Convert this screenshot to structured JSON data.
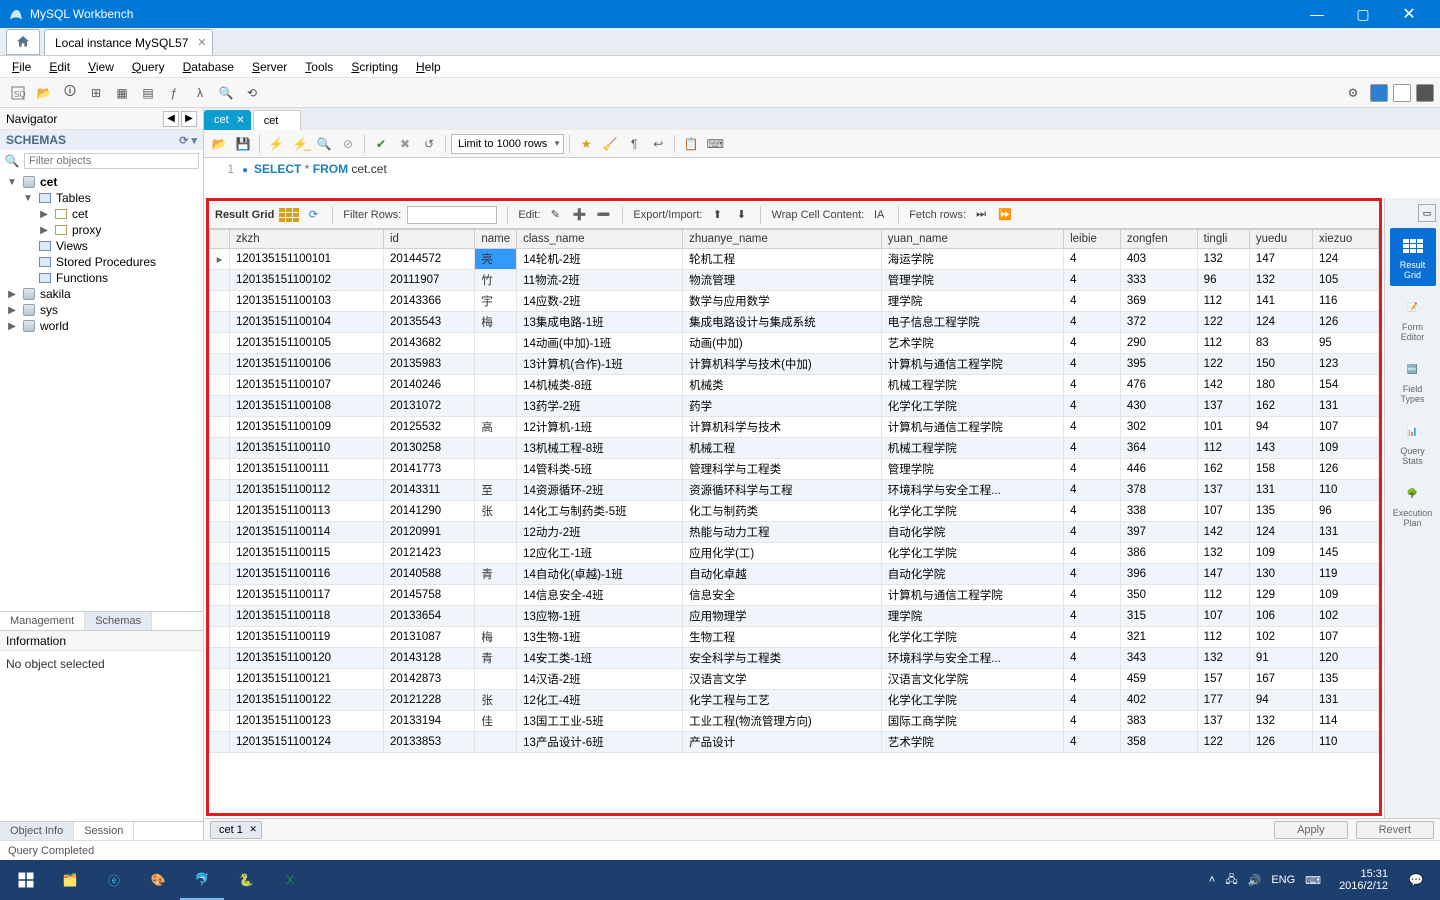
{
  "app_title": "MySQL Workbench",
  "connection_tab": "Local instance MySQL57",
  "menubar": [
    "File",
    "Edit",
    "View",
    "Query",
    "Database",
    "Server",
    "Tools",
    "Scripting",
    "Help"
  ],
  "navigator_label": "Navigator",
  "schemas_label": "SCHEMAS",
  "filter_placeholder": "Filter objects",
  "tree": {
    "cet": {
      "label": "cet",
      "tables_label": "Tables",
      "tables": [
        "cet",
        "proxy"
      ],
      "views": "Views",
      "sp": "Stored Procedures",
      "fn": "Functions"
    },
    "others": [
      "sakila",
      "sys",
      "world"
    ]
  },
  "bottom_tabs": {
    "management": "Management",
    "schemas": "Schemas"
  },
  "info_label": "Information",
  "info_body": "No object selected",
  "obj_tabs": {
    "object_info": "Object Info",
    "session": "Session"
  },
  "sql_tabs": {
    "active": "cet",
    "inactive": "cet"
  },
  "editor": {
    "limit": "Limit to 1000 rows",
    "line_no": "1",
    "sql_select": "SELECT",
    "sql_star": "*",
    "sql_from": "FROM",
    "sql_ident": "cet.cet"
  },
  "result_toolbar": {
    "result_grid": "Result Grid",
    "filter_rows": "Filter Rows:",
    "edit": "Edit:",
    "export_import": "Export/Import:",
    "wrap": "Wrap Cell Content:",
    "fetch": "Fetch rows:"
  },
  "columns": [
    "",
    "zkzh",
    "id",
    "name",
    "class_name",
    "zhuanye_name",
    "yuan_name",
    "leibie",
    "zongfen",
    "tingli",
    "yuedu",
    "xiezuo"
  ],
  "rows": [
    [
      "▸",
      "120135151100101",
      "20144572",
      "亮",
      "14轮机-2班",
      "轮机工程",
      "海运学院",
      "4",
      "403",
      "132",
      "147",
      "124"
    ],
    [
      "",
      "120135151100102",
      "20111907",
      "竹",
      "11物流-2班",
      "物流管理",
      "管理学院",
      "4",
      "333",
      "96",
      "132",
      "105"
    ],
    [
      "",
      "120135151100103",
      "20143366",
      "宇",
      "14应数-2班",
      "数学与应用数学",
      "理学院",
      "4",
      "369",
      "112",
      "141",
      "116"
    ],
    [
      "",
      "120135151100104",
      "20135543",
      "梅",
      "13集成电路-1班",
      "集成电路设计与集成系统",
      "电子信息工程学院",
      "4",
      "372",
      "122",
      "124",
      "126"
    ],
    [
      "",
      "120135151100105",
      "20143682",
      "",
      "14动画(中加)-1班",
      "动画(中加)",
      "艺术学院",
      "4",
      "290",
      "112",
      "83",
      "95"
    ],
    [
      "",
      "120135151100106",
      "20135983",
      "",
      "13计算机(合作)-1班",
      "计算机科学与技术(中加)",
      "计算机与通信工程学院",
      "4",
      "395",
      "122",
      "150",
      "123"
    ],
    [
      "",
      "120135151100107",
      "20140246",
      "",
      "14机械类-8班",
      "机械类",
      "机械工程学院",
      "4",
      "476",
      "142",
      "180",
      "154"
    ],
    [
      "",
      "120135151100108",
      "20131072",
      "",
      "13药学-2班",
      "药学",
      "化学化工学院",
      "4",
      "430",
      "137",
      "162",
      "131"
    ],
    [
      "",
      "120135151100109",
      "20125532",
      "高",
      "12计算机-1班",
      "计算机科学与技术",
      "计算机与通信工程学院",
      "4",
      "302",
      "101",
      "94",
      "107"
    ],
    [
      "",
      "120135151100110",
      "20130258",
      "",
      "13机械工程-8班",
      "机械工程",
      "机械工程学院",
      "4",
      "364",
      "112",
      "143",
      "109"
    ],
    [
      "",
      "120135151100111",
      "20141773",
      "",
      "14管科类-5班",
      "管理科学与工程类",
      "管理学院",
      "4",
      "446",
      "162",
      "158",
      "126"
    ],
    [
      "",
      "120135151100112",
      "20143311",
      "至",
      "14资源循环-2班",
      "资源循环科学与工程",
      "环境科学与安全工程...",
      "4",
      "378",
      "137",
      "131",
      "110"
    ],
    [
      "",
      "120135151100113",
      "20141290",
      "张",
      "14化工与制药类-5班",
      "化工与制药类",
      "化学化工学院",
      "4",
      "338",
      "107",
      "135",
      "96"
    ],
    [
      "",
      "120135151100114",
      "20120991",
      "",
      "12动力-2班",
      "热能与动力工程",
      "自动化学院",
      "4",
      "397",
      "142",
      "124",
      "131"
    ],
    [
      "",
      "120135151100115",
      "20121423",
      "",
      "12应化工-1班",
      "应用化学(工)",
      "化学化工学院",
      "4",
      "386",
      "132",
      "109",
      "145"
    ],
    [
      "",
      "120135151100116",
      "20140588",
      "青",
      "14自动化(卓越)-1班",
      "自动化卓越",
      "自动化学院",
      "4",
      "396",
      "147",
      "130",
      "119"
    ],
    [
      "",
      "120135151100117",
      "20145758",
      "",
      "14信息安全-4班",
      "信息安全",
      "计算机与通信工程学院",
      "4",
      "350",
      "112",
      "129",
      "109"
    ],
    [
      "",
      "120135151100118",
      "20133654",
      "",
      "13应物-1班",
      "应用物理学",
      "理学院",
      "4",
      "315",
      "107",
      "106",
      "102"
    ],
    [
      "",
      "120135151100119",
      "20131087",
      "梅",
      "13生物-1班",
      "生物工程",
      "化学化工学院",
      "4",
      "321",
      "112",
      "102",
      "107"
    ],
    [
      "",
      "120135151100120",
      "20143128",
      "青",
      "14安工类-1班",
      "安全科学与工程类",
      "环境科学与安全工程...",
      "4",
      "343",
      "132",
      "91",
      "120"
    ],
    [
      "",
      "120135151100121",
      "20142873",
      "",
      "14汉语-2班",
      "汉语言文学",
      "汉语言文化学院",
      "4",
      "459",
      "157",
      "167",
      "135"
    ],
    [
      "",
      "120135151100122",
      "20121228",
      "张",
      "12化工-4班",
      "化学工程与工艺",
      "化学化工学院",
      "4",
      "402",
      "177",
      "94",
      "131"
    ],
    [
      "",
      "120135151100123",
      "20133194",
      "佳",
      "13国工工业-5班",
      "工业工程(物流管理方向)",
      "国际工商学院",
      "4",
      "383",
      "137",
      "132",
      "114"
    ],
    [
      "",
      "120135151100124",
      "20133853",
      "",
      "13产品设计-6班",
      "产品设计",
      "艺术学院",
      "4",
      "358",
      "122",
      "126",
      "110"
    ]
  ],
  "view_strip": [
    {
      "label": "Result\nGrid"
    },
    {
      "label": "Form\nEditor"
    },
    {
      "label": "Field\nTypes"
    },
    {
      "label": "Query\nStats"
    },
    {
      "label": "Execution\nPlan"
    }
  ],
  "result_tab": "cet 1",
  "apply": "Apply",
  "revert": "Revert",
  "status": "Query Completed",
  "tray": {
    "ime": "ENG",
    "time": "15:31",
    "date": "2016/2/12"
  }
}
